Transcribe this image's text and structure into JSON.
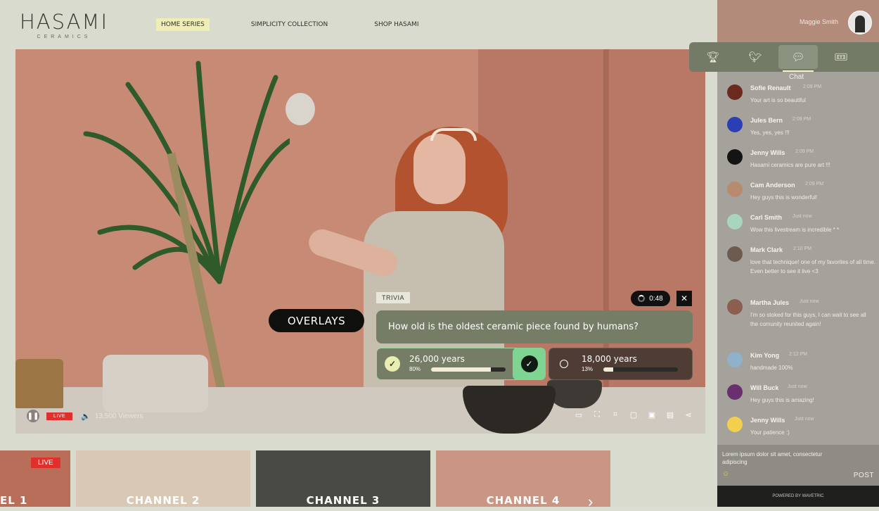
{
  "brand": {
    "name": "HASAMI",
    "tagline": "CERAMICS"
  },
  "nav": {
    "items": [
      {
        "label": "HOME SERIES"
      },
      {
        "label": "SIMPLICITY COLLECTION"
      },
      {
        "label": "SHOP HASAMI"
      }
    ]
  },
  "user": {
    "name": "Maggie Smith"
  },
  "player": {
    "live_label": "LIVE",
    "viewers": "13,500 Viewers"
  },
  "overlay": {
    "pill_label": "OVERLAYS",
    "tag": "TRIVIA",
    "timer": "0:48",
    "close": "✕",
    "question": "How old is the oldest ceramic piece found by humans?",
    "answers": [
      {
        "label": "26,000 years",
        "percent": "80%",
        "fill": 0.8,
        "selected": true
      },
      {
        "label": "18,000 years",
        "percent": "13%",
        "fill": 0.13,
        "selected": false
      }
    ]
  },
  "tabs": {
    "active_caption": "Chat",
    "icons": [
      "trophy-icon",
      "twitter-icon",
      "chat-icon",
      "ticket-icon"
    ]
  },
  "chat": {
    "messages": [
      {
        "name": "Sofie Renault",
        "time": "2:09 PM",
        "text": "Your art is so beautiful",
        "color": "#6b2a1d"
      },
      {
        "name": "Jules Bern",
        "time": "2:09 PM",
        "text": "Yes, yes, yes !!!",
        "color": "#2a3fb5"
      },
      {
        "name": "Jenny Wills",
        "time": "2:09 PM",
        "text": "Hasami ceramics are pure art !!!",
        "color": "#141414"
      },
      {
        "name": "Cam Anderson",
        "time": "2:09 PM",
        "text": "Hey guys this is wonderful!",
        "color": "#b98b6e"
      },
      {
        "name": "Carl Smith",
        "time": "Just now",
        "text": "Wow this livestream is incredible * *",
        "color": "#a9d5be"
      },
      {
        "name": "Mark Clark",
        "time": "2:10 PM",
        "text": "love that technique! one of my favorites of all time. Even better to see it live <3",
        "color": "#6d5b50"
      },
      {
        "name": "Martha Jules",
        "time": "Just now",
        "text": "I'm so stoked for this guys, I can wait to see all the comunity reunited again!",
        "color": "#8b5e4f"
      },
      {
        "name": "Kim Yong",
        "time": "2:12 PM",
        "text": "handmade 100%",
        "color": "#8fb1c9"
      },
      {
        "name": "Will Buck",
        "time": "Just now",
        "text": "Hey guys this is amazing!",
        "color": "#6a2f6e"
      },
      {
        "name": "Jenny Wills",
        "time": "Just now",
        "text": "Your patience :)",
        "color": "#f2cf4c"
      }
    ],
    "input_placeholder": "Lorem ipsum dolor sit amet, consectetur adipiscing",
    "post_label": "POST",
    "powered_by": "POWERED BY WAVETRIC"
  },
  "channels": [
    {
      "name": "EL 1",
      "live": "LIVE"
    },
    {
      "name": "CHANNEL 2"
    },
    {
      "name": "CHANNEL 3"
    },
    {
      "name": "CHANNEL 4"
    }
  ]
}
